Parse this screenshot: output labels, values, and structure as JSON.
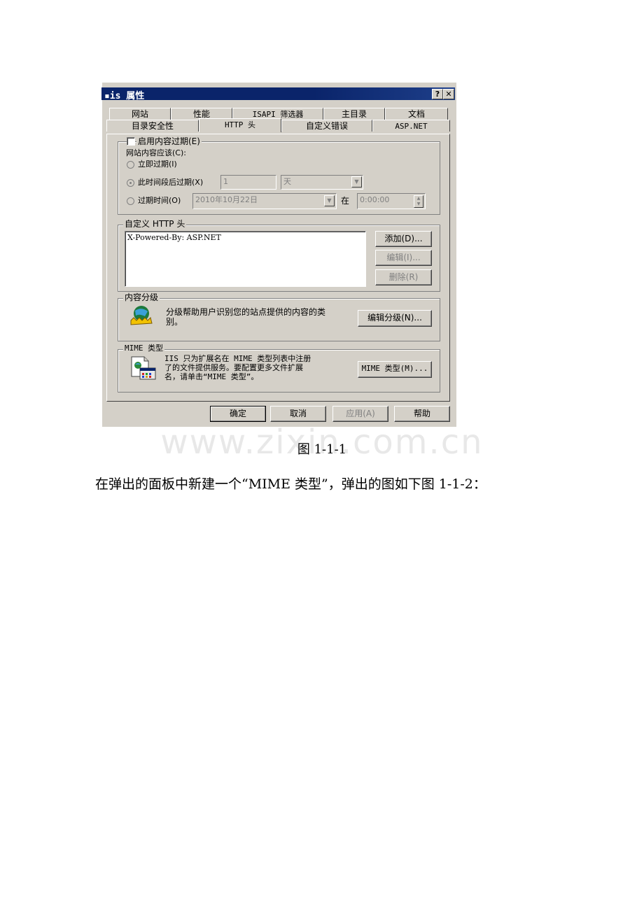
{
  "dialog": {
    "title": "▪is 属性",
    "help_button": "?",
    "close_button": "✕",
    "tabs_row1": [
      "网站",
      "性能",
      "ISAPI 筛选器",
      "主目录",
      "文档"
    ],
    "tabs_row2": [
      "目录安全性",
      "HTTP 头",
      "自定义错误",
      "ASP.NET"
    ],
    "active_tab": "HTTP 头",
    "expire": {
      "checkbox_label": "启用内容过期(E)",
      "content_should": "网站内容应该(C):",
      "immediate": "立即过期(I)",
      "after_period": "此时间段后过期(X)",
      "period_value": "1",
      "period_unit": "天",
      "at_time": "过期时间(O)",
      "date_value": "2010年10月22日",
      "at_label": "在",
      "time_value": "0:00:00"
    },
    "custom_http": {
      "group_label": "自定义 HTTP 头",
      "headers": [
        "X-Powered-By: ASP.NET"
      ],
      "add_button": "添加(D)...",
      "edit_button": "编辑(I)...",
      "remove_button": "删除(R)"
    },
    "rating": {
      "group_label": "内容分级",
      "text_line1": "分级帮助用户识别您的站点提供的内容的类",
      "text_line2": "别。",
      "edit_button": "编辑分级(N)..."
    },
    "mime": {
      "group_label": "MIME 类型",
      "text_line1": "IIS 只为扩展名在 MIME 类型列表中注册",
      "text_line2": "了的文件提供服务。要配置更多文件扩展",
      "text_line3": "名，请单击“MIME 类型”。",
      "button": "MIME 类型(M)..."
    },
    "footer": {
      "ok": "确定",
      "cancel": "取消",
      "apply": "应用(A)",
      "help": "帮助"
    }
  },
  "watermark": "www.zixin.com.cn",
  "caption": "图 1-1-1",
  "paragraph": "在弹出的面板中新建一个“MIME 类型”，弹出的图如下图 1-1-2："
}
